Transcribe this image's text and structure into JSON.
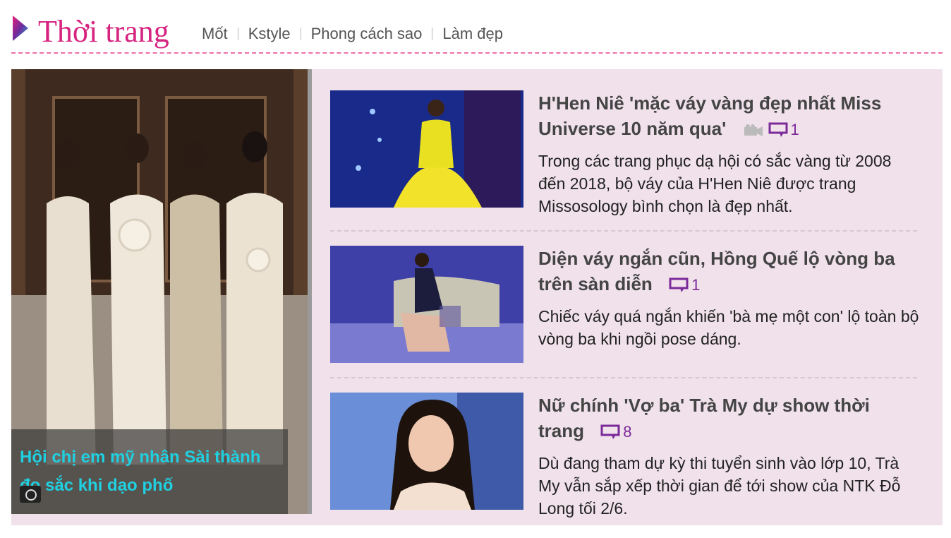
{
  "section": {
    "title": "Thời trang",
    "subnav": [
      "Mốt",
      "Kstyle",
      "Phong cách sao",
      "Làm đẹp"
    ]
  },
  "feature": {
    "title": "Hội chị em mỹ nhân Sài thành đọ sắc khi dạo phố",
    "icon": "camera-icon"
  },
  "articles": [
    {
      "title": "H'Hen Niê 'mặc váy vàng đẹp nhất Miss Universe 10 năm qua'",
      "has_video": true,
      "comments": "1",
      "summary": "Trong các trang phục dạ hội có sắc vàng từ 2008 đến 2018, bộ váy của H'Hen Niê được trang Missosology bình chọn là đẹp nhất."
    },
    {
      "title": "Diện váy ngắn cũn, Hồng Quế lộ vòng ba trên sàn diễn",
      "has_video": false,
      "comments": "1",
      "summary": "Chiếc váy quá ngắn khiến 'bà mẹ một con' lộ toàn bộ vòng ba khi ngồi pose dáng."
    },
    {
      "title": "Nữ chính 'Vợ ba' Trà My dự show thời trang",
      "has_video": false,
      "comments": "8",
      "summary": "Dù đang tham dự kỳ thi tuyển sinh vào lớp 10, Trà My vẫn sắp xếp thời gian để tới show của NTK Đỗ Long tối 2/6."
    }
  ],
  "colors": {
    "brand": "#d6237f",
    "panel_bg": "#f0e1ea",
    "caption_text": "#20d0e0",
    "comment": "#7b2a9a"
  }
}
